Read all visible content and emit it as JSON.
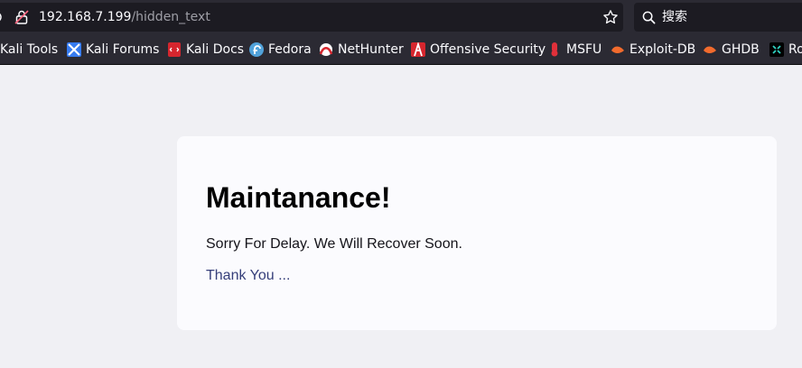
{
  "browser": {
    "url_host": "192.168.7.199",
    "url_path": "/hidden_text",
    "search_placeholder": "搜索",
    "bookmarks": [
      {
        "label": "Kali Tools",
        "icon": "kali-tools-favicon"
      },
      {
        "label": "Kali Forums",
        "icon": "kali-forums-favicon"
      },
      {
        "label": "Kali Docs",
        "icon": "kali-docs-favicon"
      },
      {
        "label": "Fedora",
        "icon": "fedora-favicon"
      },
      {
        "label": "NetHunter",
        "icon": "nethunter-favicon"
      },
      {
        "label": "Offensive Security",
        "icon": "offensive-security-favicon"
      },
      {
        "label": "MSFU",
        "icon": "msfu-favicon"
      },
      {
        "label": "Exploit-DB",
        "icon": "exploit-db-favicon"
      },
      {
        "label": "GHDB",
        "icon": "ghdb-favicon"
      },
      {
        "label": "Ro",
        "icon": "ro-favicon"
      }
    ]
  },
  "page": {
    "title": "Maintanance!",
    "message": "Sorry For Delay. We Will Recover Soon.",
    "thanks": "Thank You ..."
  }
}
